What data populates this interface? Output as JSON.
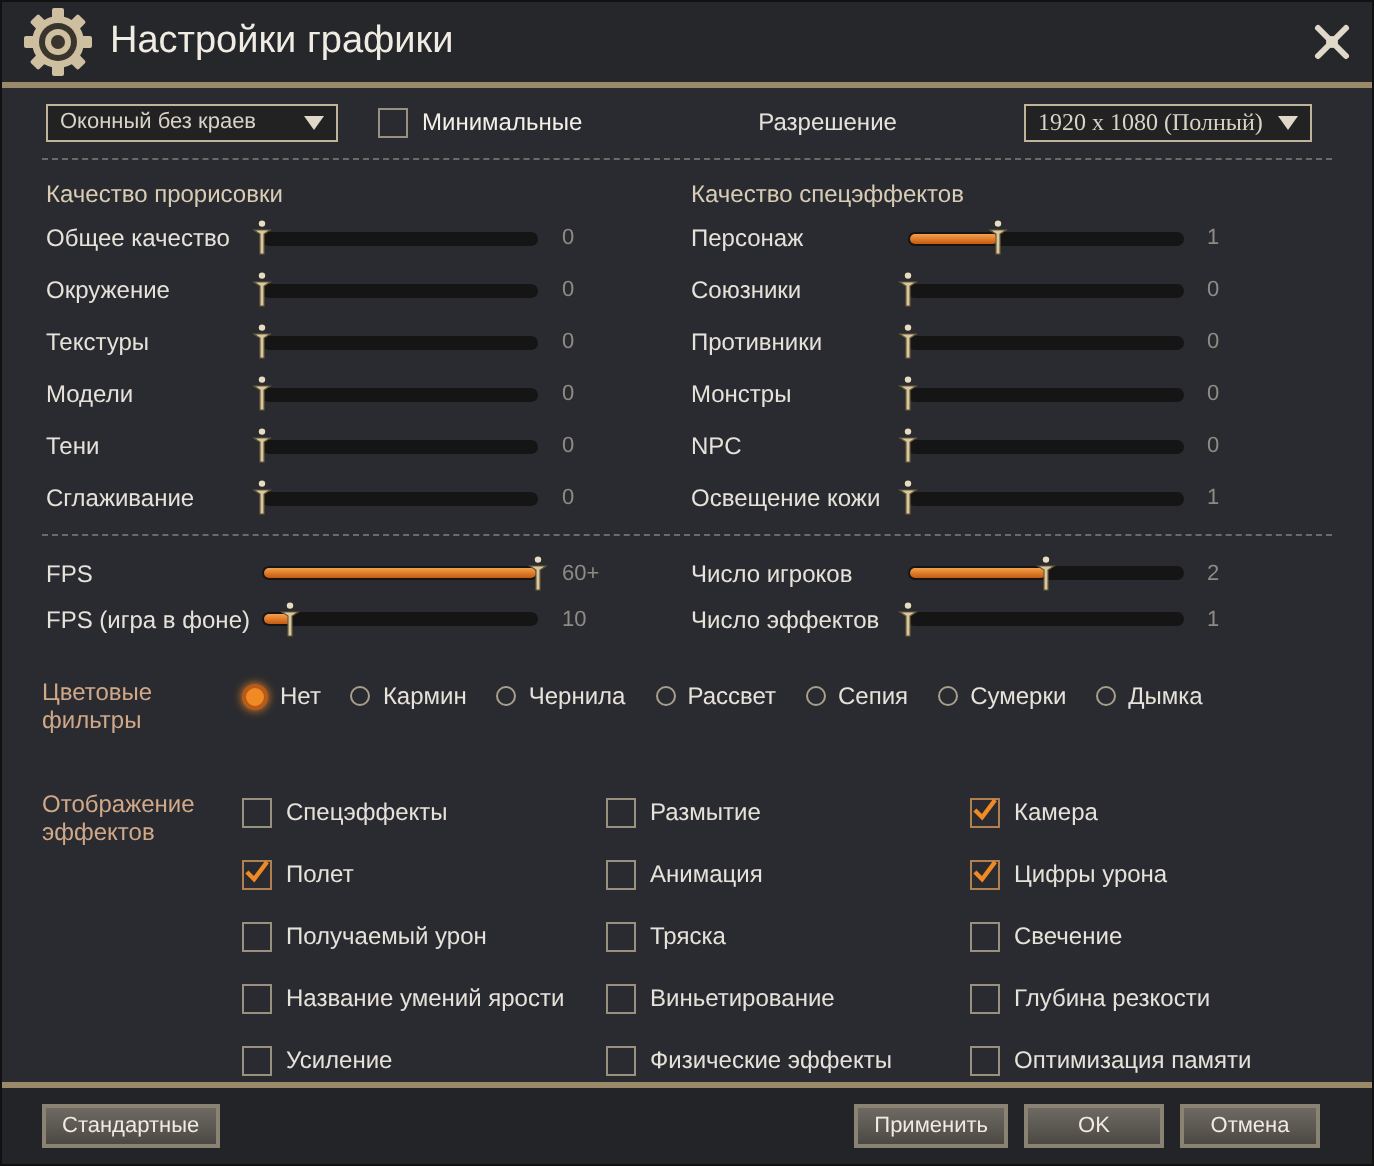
{
  "window": {
    "title": "Настройки графики"
  },
  "top": {
    "display_mode": {
      "value": "Оконный без краев"
    },
    "minimal": {
      "label": "Минимальные",
      "checked": false
    },
    "resolution": {
      "label": "Разрешение",
      "value": "1920 x 1080 (Полный)"
    }
  },
  "render_quality": {
    "title": "Качество прорисовки",
    "sliders": [
      {
        "label": "Общее качество",
        "level": 0,
        "reading": "0"
      },
      {
        "label": "Окружение",
        "level": 0,
        "reading": "0"
      },
      {
        "label": "Текстуры",
        "level": 0,
        "reading": "0"
      },
      {
        "label": "Модели",
        "level": 0,
        "reading": "0"
      },
      {
        "label": "Тени",
        "level": 0,
        "reading": "0"
      },
      {
        "label": "Сглаживание",
        "level": 0,
        "reading": "0"
      }
    ]
  },
  "effects_quality": {
    "title": "Качество спецэффектов",
    "sliders": [
      {
        "label": "Персонаж",
        "level": 0.33,
        "reading": "1"
      },
      {
        "label": "Союзники",
        "level": 0,
        "reading": "0"
      },
      {
        "label": "Противники",
        "level": 0,
        "reading": "0"
      },
      {
        "label": "Монстры",
        "level": 0,
        "reading": "0"
      },
      {
        "label": "NPC",
        "level": 0,
        "reading": "0"
      },
      {
        "label": "Освещение кожи",
        "level": 0,
        "reading": "1"
      }
    ]
  },
  "performance": {
    "left": [
      {
        "label": "FPS",
        "level": 1,
        "reading": "60+"
      },
      {
        "label": "FPS (игра в фоне)",
        "level": 0.1,
        "reading": "10"
      }
    ],
    "right": [
      {
        "label": "Число игроков",
        "level": 0.5,
        "reading": "2"
      },
      {
        "label": "Число эффектов",
        "level": 0,
        "reading": "1"
      }
    ]
  },
  "color_filters": {
    "label": "Цветовые фильтры",
    "options": [
      {
        "label": "Нет",
        "selected": true
      },
      {
        "label": "Кармин",
        "selected": false
      },
      {
        "label": "Чернила",
        "selected": false
      },
      {
        "label": "Рассвет",
        "selected": false
      },
      {
        "label": "Сепия",
        "selected": false
      },
      {
        "label": "Сумерки",
        "selected": false
      },
      {
        "label": "Дымка",
        "selected": false
      }
    ]
  },
  "effect_display": {
    "label": "Отображение эффектов",
    "options": [
      {
        "label": "Спецэффекты",
        "checked": false
      },
      {
        "label": "Размытие",
        "checked": false
      },
      {
        "label": "Камера",
        "checked": true
      },
      {
        "label": "Полет",
        "checked": true
      },
      {
        "label": "Анимация",
        "checked": false
      },
      {
        "label": "Цифры урона",
        "checked": true
      },
      {
        "label": "Получаемый урон",
        "checked": false
      },
      {
        "label": "Тряска",
        "checked": false
      },
      {
        "label": "Свечение",
        "checked": false
      },
      {
        "label": "Название умений ярости",
        "checked": false
      },
      {
        "label": "Виньетирование",
        "checked": false
      },
      {
        "label": "Глубина резкости",
        "checked": false
      },
      {
        "label": "Усиление",
        "checked": false
      },
      {
        "label": "Физические эффекты",
        "checked": false
      },
      {
        "label": "Оптимизация памяти",
        "checked": false
      }
    ]
  },
  "buttons": [
    {
      "label": "Стандартные",
      "kind": "left"
    },
    {
      "label": "Применить",
      "kind": "right"
    },
    {
      "label": "OK",
      "kind": "right"
    },
    {
      "label": "Отмена",
      "kind": "right"
    }
  ]
}
